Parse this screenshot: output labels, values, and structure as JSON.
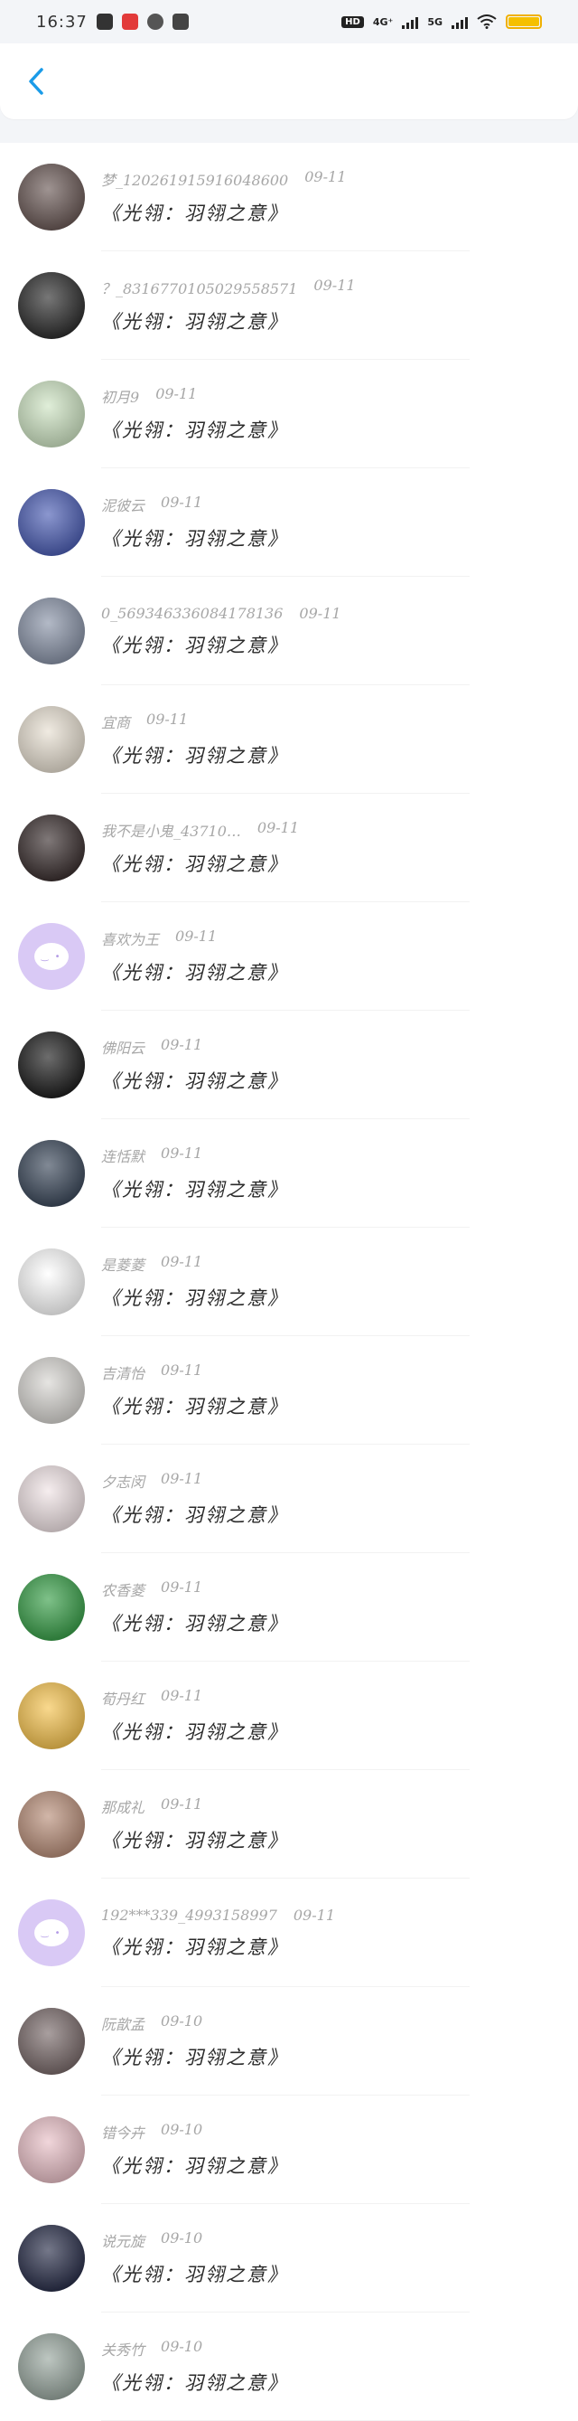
{
  "status": {
    "time": "16:37",
    "hd": "HD",
    "net1": "4G⁺",
    "net2": "5G"
  },
  "list": [
    {
      "name": "梦_120261915916048600",
      "date": "09-11",
      "title": "《光翎：羽翎之意》",
      "avatar": "avatar-photo-dark",
      "bg": "#6b5a57"
    },
    {
      "name": "？_8316770105029558571",
      "date": "09-11",
      "title": "《光翎：羽翎之意》",
      "avatar": "avatar-photo-dark",
      "bg": "#2e2e2e"
    },
    {
      "name": "初月9",
      "date": "09-11",
      "title": "《光翎：羽翎之意》",
      "avatar": "avatar-anime-girl",
      "bg": "#cfe5c4"
    },
    {
      "name": "泥彼云",
      "date": "09-11",
      "title": "《光翎：羽翎之意》",
      "avatar": "avatar-buddha",
      "bg": "#4d5fb5"
    },
    {
      "name": "0_569346336084178136",
      "date": "09-11",
      "title": "《光翎：羽翎之意》",
      "avatar": "avatar-scenery",
      "bg": "#8a94a8"
    },
    {
      "name": "宜商",
      "date": "09-11",
      "title": "《光翎：羽翎之意》",
      "avatar": "avatar-text-image",
      "bg": "#e8e0d2"
    },
    {
      "name": "我不是小鬼_43710…",
      "date": "09-11",
      "title": "《光翎：羽翎之意》",
      "avatar": "avatar-photo-man",
      "bg": "#3b3030"
    },
    {
      "name": "喜欢为王",
      "date": "09-11",
      "title": "《光翎：羽翎之意》",
      "avatar": "default-avatar",
      "bg": "#d9c9f5"
    },
    {
      "name": "佛阳云",
      "date": "09-11",
      "title": "《光翎：羽翎之意》",
      "avatar": "avatar-photo-dark",
      "bg": "#1e1e1e"
    },
    {
      "name": "连恬默",
      "date": "09-11",
      "title": "《光翎：羽翎之意》",
      "avatar": "avatar-photo",
      "bg": "#3d4a5c"
    },
    {
      "name": "是菱菱",
      "date": "09-11",
      "title": "《光翎：羽翎之意》",
      "avatar": "avatar-tree",
      "bg": "#ffffff"
    },
    {
      "name": "吉清怡",
      "date": "09-11",
      "title": "《光翎：羽翎之意》",
      "avatar": "avatar-photo-light",
      "bg": "#d8d6d2"
    },
    {
      "name": "夕志闵",
      "date": "09-11",
      "title": "《光翎：羽翎之意》",
      "avatar": "avatar-flower",
      "bg": "#f1e4e6"
    },
    {
      "name": "农香菱",
      "date": "09-11",
      "title": "《光翎：羽翎之意》",
      "avatar": "avatar-cartoon",
      "bg": "#3aa04a"
    },
    {
      "name": "荀丹红",
      "date": "09-11",
      "title": "《光翎：羽翎之意》",
      "avatar": "avatar-lion",
      "bg": "#f6c451"
    },
    {
      "name": "那成礼",
      "date": "09-11",
      "title": "《光翎：羽翎之意》",
      "avatar": "avatar-photo-girl",
      "bg": "#b98f7a"
    },
    {
      "name": "192***339_4993158997",
      "date": "09-11",
      "title": "《光翎：羽翎之意》",
      "avatar": "default-avatar",
      "bg": "#d9c9f5"
    },
    {
      "name": "阮歆孟",
      "date": "09-10",
      "title": "《光翎：羽翎之意》",
      "avatar": "avatar-photo-girl",
      "bg": "#7a6b6b"
    },
    {
      "name": "错今卉",
      "date": "09-10",
      "title": "《光翎：羽翎之意》",
      "avatar": "avatar-anime-pink",
      "bg": "#e9c0c7"
    },
    {
      "name": "说元旋",
      "date": "09-10",
      "title": "《光翎：羽翎之意》",
      "avatar": "avatar-text-gold",
      "bg": "#2a2f4a"
    },
    {
      "name": "关秀竹",
      "date": "09-10",
      "title": "《光翎：羽翎之意》",
      "avatar": "avatar-photo-girl",
      "bg": "#9aa8a0"
    }
  ]
}
